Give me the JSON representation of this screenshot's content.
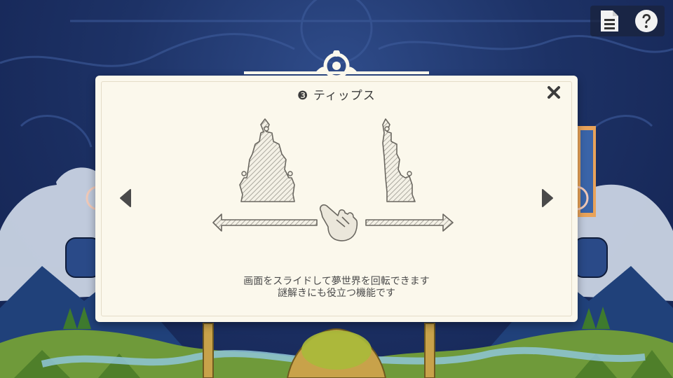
{
  "header": {
    "buttons": [
      {
        "name": "document-icon"
      },
      {
        "name": "help-icon"
      }
    ]
  },
  "dialog": {
    "step_marker": "❸",
    "title": "ティップス",
    "close_icon": "close-icon",
    "description_lines": [
      "画面をスライドして夢世界を回転できます",
      "謎解きにも役立つ機能です"
    ],
    "prev_icon": "triangle-left-icon",
    "next_icon": "triangle-right-icon"
  },
  "colors": {
    "background": "#1d3266",
    "dialog_bg": "#fbf8ec",
    "text": "#3c3c3c",
    "icon_dark": "#4a4a4a"
  }
}
